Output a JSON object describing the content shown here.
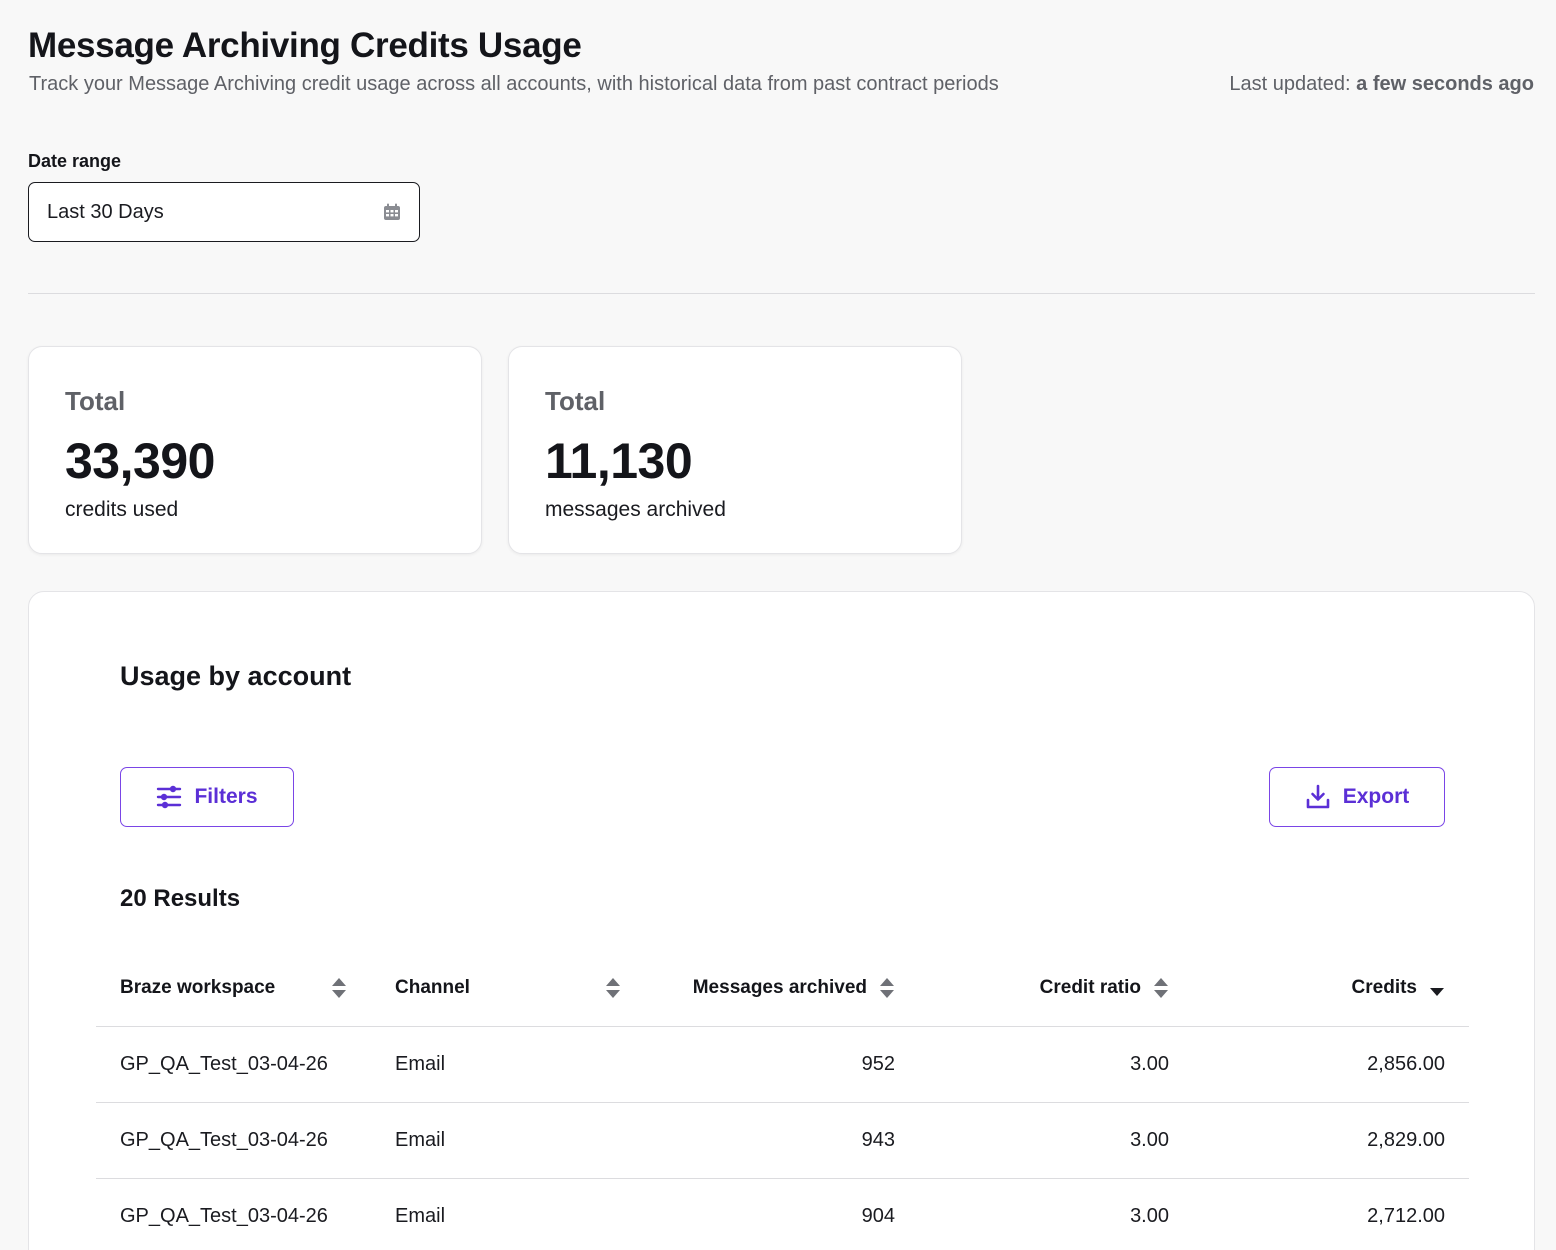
{
  "header": {
    "title": "Message Archiving Credits Usage",
    "subtitle": "Track your Message Archiving credit usage across all accounts, with historical data from past contract periods",
    "last_updated_label": "Last updated:",
    "last_updated_value": "a few seconds ago"
  },
  "date_range": {
    "label": "Date range",
    "value": "Last 30 Days",
    "icon": "calendar-icon"
  },
  "stats": [
    {
      "kicker": "Total",
      "value": "33,390",
      "unit": "credits used"
    },
    {
      "kicker": "Total",
      "value": "11,130",
      "unit": "messages archived"
    }
  ],
  "usage": {
    "title": "Usage by account",
    "filters_label": "Filters",
    "export_label": "Export",
    "results_label": "20 Results",
    "columns": [
      "Braze workspace",
      "Channel",
      "Messages archived",
      "Credit ratio",
      "Credits"
    ],
    "sorted_column": "Credits",
    "sort_direction": "descending",
    "rows": [
      {
        "workspace": "GP_QA_Test_03-04-26",
        "channel": "Email",
        "messages": "952",
        "ratio": "3.00",
        "credits": "2,856.00"
      },
      {
        "workspace": "GP_QA_Test_03-04-26",
        "channel": "Email",
        "messages": "943",
        "ratio": "3.00",
        "credits": "2,829.00"
      },
      {
        "workspace": "GP_QA_Test_03-04-26",
        "channel": "Email",
        "messages": "904",
        "ratio": "3.00",
        "credits": "2,712.00"
      }
    ]
  },
  "colors": {
    "accent": "#5b2fd6",
    "accent_border": "#7a45e6",
    "page_bg": "#f8f8f8"
  }
}
